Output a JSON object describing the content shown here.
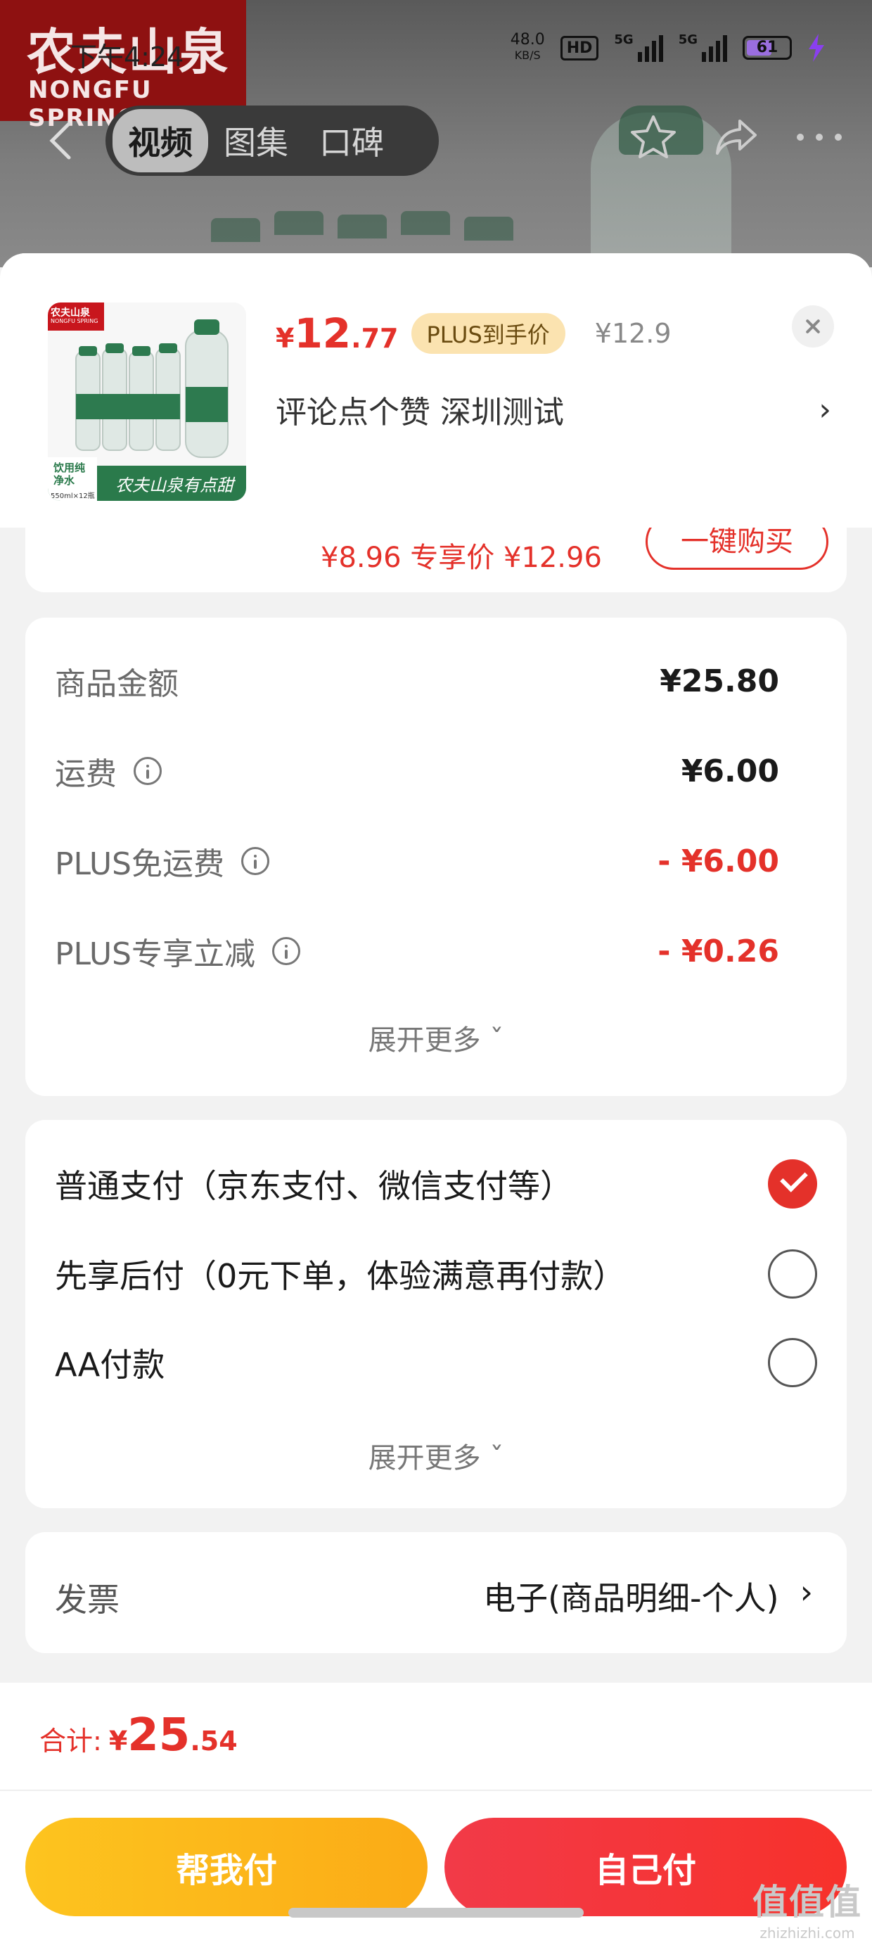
{
  "status_bar": {
    "time": "下午4:24",
    "net_speed_value": "48.0",
    "net_speed_unit": "KB/S",
    "hd": "HD",
    "sig1_label": "5G",
    "sig2_label": "5G",
    "battery": "61",
    "battery_level": 0.61
  },
  "brand": {
    "logo_cn": "农夫山泉",
    "logo_en": "NONGFU SPRING"
  },
  "nav": {
    "tabs": [
      {
        "label": "视频",
        "active": true
      },
      {
        "label": "图集",
        "active": false
      },
      {
        "label": "口碑",
        "active": false
      }
    ]
  },
  "product": {
    "thumb": {
      "brand": "农夫山泉",
      "brand_en": "NONGFU SPRING",
      "label": "饮用纯净水",
      "spec": "550ml×12瓶",
      "slogan": "农夫山泉有点甜"
    },
    "price_currency": "¥",
    "price_int": "12",
    "price_dec": ".77",
    "plus_tag": "PLUS到手价",
    "original_price": "¥12.9",
    "spec_text": "评论点个赞  深圳测试",
    "spec_chevron": "›"
  },
  "peek": {
    "text": "¥8.96 专享价  ¥12.96",
    "button": "一键购买"
  },
  "amounts": {
    "rows": [
      {
        "label": "商品金额",
        "value": "¥25.80",
        "info": false,
        "red": false
      },
      {
        "label": "运费",
        "value": "¥6.00",
        "info": true,
        "red": false
      },
      {
        "label": "PLUS免运费",
        "value": "- ¥6.00",
        "info": true,
        "red": true
      },
      {
        "label": "PLUS专享立减",
        "value": "- ¥0.26",
        "info": true,
        "red": true
      }
    ],
    "expand": "展开更多 ˇ"
  },
  "payment": {
    "options": [
      {
        "label": "普通支付（京东支付、微信支付等）",
        "checked": true
      },
      {
        "label": "先享后付（0元下单，体验满意再付款）",
        "checked": false
      },
      {
        "label": "AA付款",
        "checked": false
      }
    ],
    "expand": "展开更多 ˇ"
  },
  "invoice": {
    "label": "发票",
    "value": "电子(商品明细-个人)",
    "chevron": "›"
  },
  "footer": {
    "total_label": "合计:",
    "total_currency": "¥",
    "total_int": "25",
    "total_dec": ".54",
    "help_pay": "帮我付",
    "self_pay": "自己付"
  },
  "watermark": {
    "glyphs": "值值值",
    "domain": "zhizhizhi.com"
  },
  "colors": {
    "accent_red": "#e4312a",
    "help_yellow": "#fdc41f",
    "plus_gold": "#fbe3b0"
  }
}
